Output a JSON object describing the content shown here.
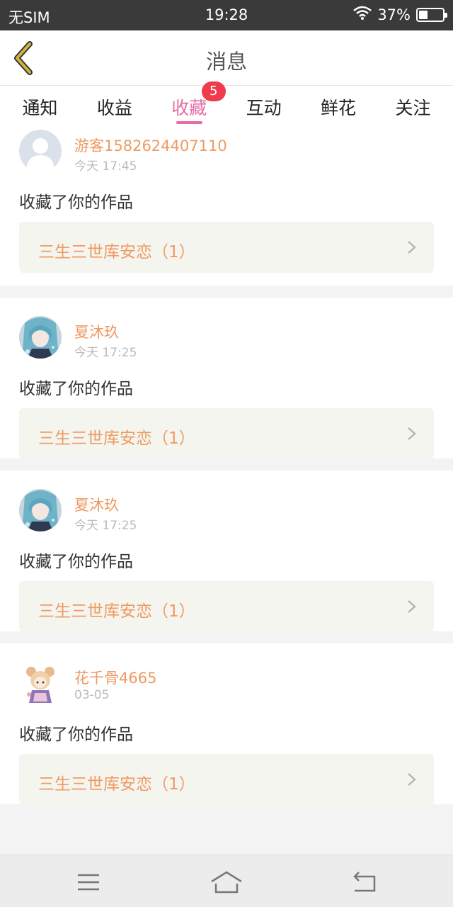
{
  "status": {
    "carrier": "无SIM",
    "time": "19:28",
    "battery": "37%",
    "battery_level": 0.37
  },
  "header": {
    "title": "消息",
    "back_icon": "back-chevron-icon"
  },
  "tabs": [
    {
      "label": "通知"
    },
    {
      "label": "收益"
    },
    {
      "label": "收藏",
      "active": true,
      "badge": "5"
    },
    {
      "label": "互动"
    },
    {
      "label": "鲜花"
    },
    {
      "label": "关注"
    }
  ],
  "items": [
    {
      "user": "游客1582624407110",
      "time": "今天 17:45",
      "action": "收藏了你的作品",
      "work": "三生三世库安恋（1）",
      "avatar": "default-avatar"
    },
    {
      "user": "夏沐玖",
      "time": "今天 17:25",
      "action": "收藏了你的作品",
      "work": "三生三世库安恋（1）",
      "avatar": "anime-avatar"
    },
    {
      "user": "夏沐玖",
      "time": "今天 17:25",
      "action": "收藏了你的作品",
      "work": "三生三世库安恋（1）",
      "avatar": "anime-avatar"
    },
    {
      "user": "花千骨4665",
      "time": "03-05",
      "action": "收藏了你的作品",
      "work": "三生三世库安恋（1）",
      "avatar": "chibi-avatar"
    }
  ],
  "colors": {
    "accent": "#e46da5",
    "badge": "#f03b4d",
    "username": "#ef9a62",
    "back_icon": "#d2b53c"
  },
  "bottom_nav": [
    "menu-icon",
    "home-icon",
    "return-icon"
  ]
}
